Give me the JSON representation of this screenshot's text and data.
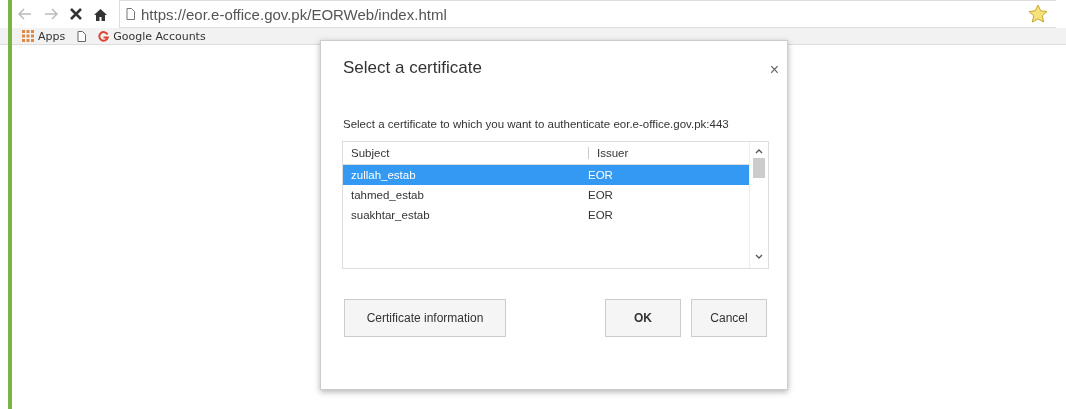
{
  "browser": {
    "url": "https://eor.e-office.gov.pk/EORWeb/index.html",
    "bookmarks": [
      {
        "kind": "apps",
        "label": "Apps"
      },
      {
        "kind": "page"
      },
      {
        "kind": "google",
        "label": "Google Accounts"
      }
    ],
    "loading": true
  },
  "dialog": {
    "title": "Select a certificate",
    "close": "×",
    "message": "Select a certificate to which you want to authenticate eor.e-office.gov.pk:443",
    "columns": [
      "Subject",
      "Issuer"
    ],
    "rows": [
      {
        "subject": "zullah_estab",
        "issuer": "EOR",
        "selected": true
      },
      {
        "subject": "tahmed_estab",
        "issuer": "EOR",
        "selected": false
      },
      {
        "subject": "suakhtar_estab",
        "issuer": "EOR",
        "selected": false
      }
    ],
    "buttons": {
      "info": "Certificate information",
      "ok": "OK",
      "cancel": "Cancel"
    }
  }
}
